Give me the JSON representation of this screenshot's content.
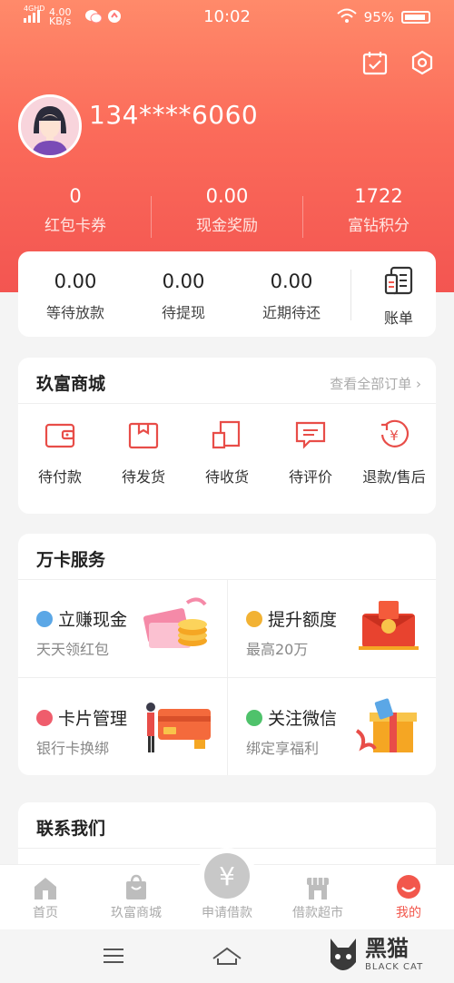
{
  "status_bar": {
    "network": "4GHD",
    "speed": "4.00 KB/s",
    "time": "10:02",
    "battery": "95%"
  },
  "profile": {
    "phone": "134****6060"
  },
  "stats": [
    {
      "value": "0",
      "label": "红包卡券"
    },
    {
      "value": "0.00",
      "label": "现金奖励"
    },
    {
      "value": "1722",
      "label": "富钻积分"
    }
  ],
  "loan": {
    "items": [
      {
        "value": "0.00",
        "label": "等待放款"
      },
      {
        "value": "0.00",
        "label": "待提现"
      },
      {
        "value": "0.00",
        "label": "近期待还"
      }
    ],
    "bill_label": "账单"
  },
  "shop": {
    "title": "玖富商城",
    "link": "查看全部订单",
    "items": [
      {
        "label": "待付款",
        "icon": "wallet-icon"
      },
      {
        "label": "待发货",
        "icon": "package-icon"
      },
      {
        "label": "待收货",
        "icon": "receive-icon"
      },
      {
        "label": "待评价",
        "icon": "comment-icon"
      },
      {
        "label": "退款/售后",
        "icon": "refund-icon"
      }
    ]
  },
  "services": {
    "title": "万卡服务",
    "items": [
      {
        "title": "立赚现金",
        "sub": "天天领红包",
        "icon": "gift-icon",
        "color": "#5ba7e6"
      },
      {
        "title": "提升额度",
        "sub": "最高20万",
        "icon": "boost-icon",
        "color": "#f2b233"
      },
      {
        "title": "卡片管理",
        "sub": "银行卡换绑",
        "icon": "card-icon",
        "color": "#ef5d6c"
      },
      {
        "title": "关注微信",
        "sub": "绑定享福利",
        "icon": "wechat-icon",
        "color": "#4fc26b"
      }
    ]
  },
  "contact": {
    "title": "联系我们"
  },
  "tabs": [
    {
      "label": "首页",
      "icon": "home-icon"
    },
    {
      "label": "玖富商城",
      "icon": "bag-icon"
    },
    {
      "label": "申请借款",
      "icon": "yen-icon"
    },
    {
      "label": "借款超市",
      "icon": "store-icon"
    },
    {
      "label": "我的",
      "icon": "profile-icon"
    }
  ],
  "center_symbol": "¥",
  "watermark": {
    "text": "黑猫",
    "sub": "BLACK CAT"
  },
  "colors": {
    "accent": "#f2574c",
    "hero_top": "#ff8a6a",
    "hero_bottom": "#f35551"
  }
}
